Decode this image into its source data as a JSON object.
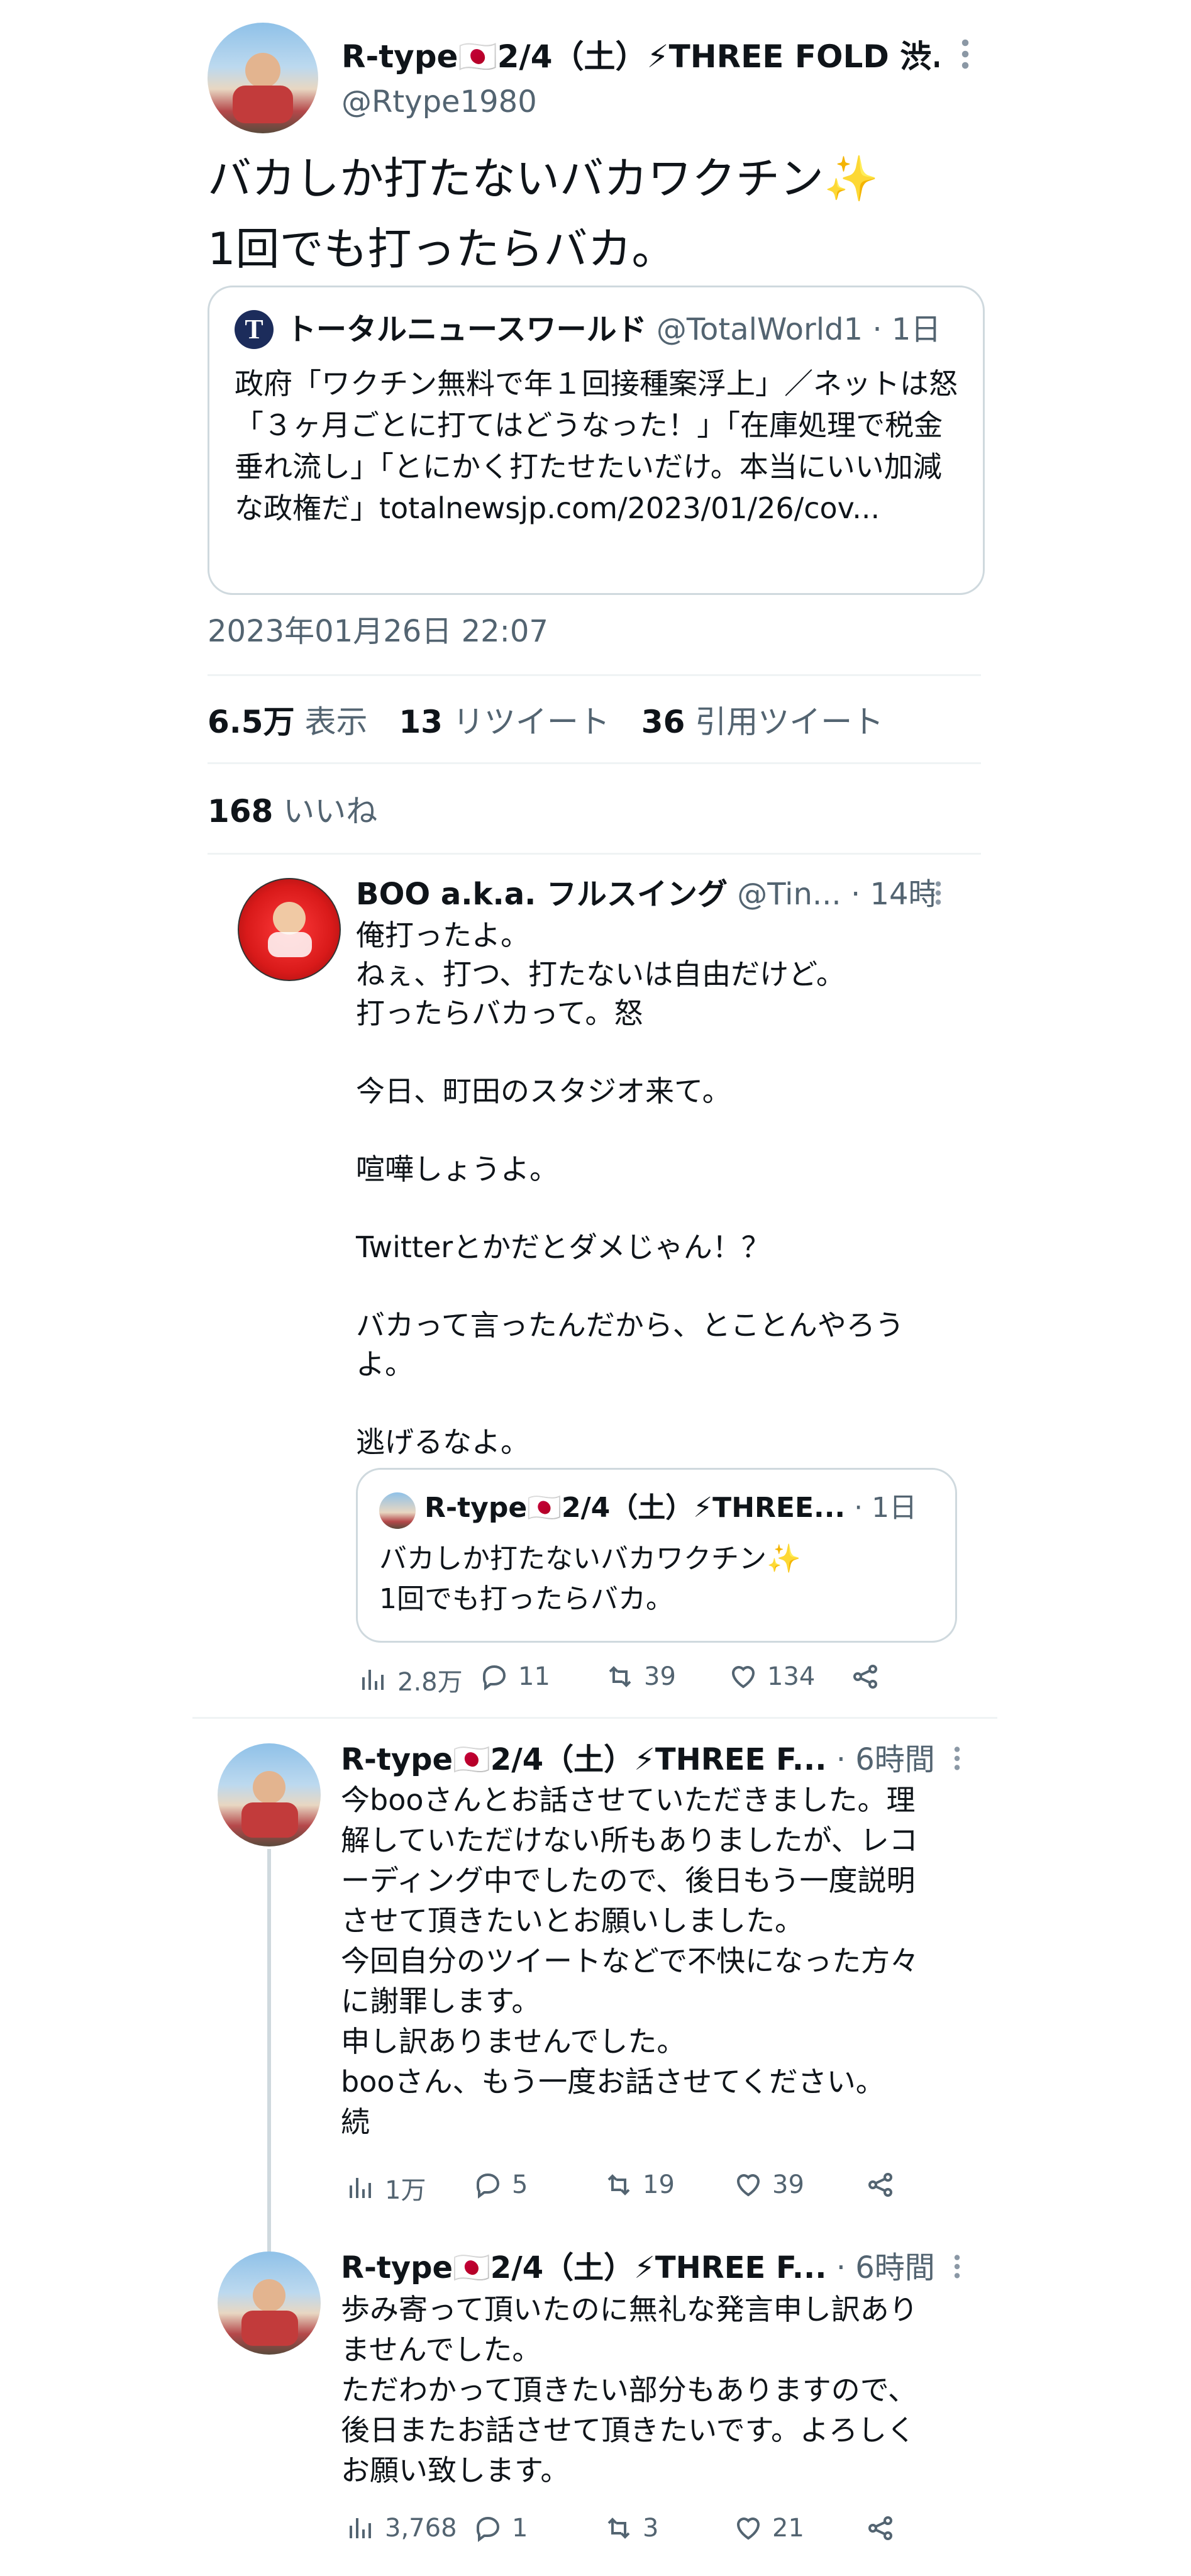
{
  "main_tweet": {
    "display_name": "R-type🇯🇵2/4（土）⚡THREE FOLD 渋...",
    "handle": "@Rtype1980",
    "text": "バカしか打たないバカワクチン✨\n1回でも打ったらバカ。",
    "quoted": {
      "source_name": "トータルニュースワールド",
      "source_handle": "@TotalWorld1",
      "age": "· 1日",
      "logo_letter": "T",
      "text": "政府「ワクチン無料で年１回接種案浮上」／ネットは怒「３ヶ月ごとに打てはどうなった！」「在庫処理で税金垂れ流し」「とにかく打たせたいだけ。本当にいい加減な政権だ」totalnewsjp.com/2023/01/26/cov..."
    },
    "timestamp": "2023年01月26日 22:07",
    "stats": {
      "views_count": "6.5万",
      "views_label": "表示",
      "retweets_count": "13",
      "retweets_label": "リツイート",
      "quotes_count": "36",
      "quotes_label": "引用ツイート",
      "likes_count": "168",
      "likes_label": "いいね"
    }
  },
  "reply_boo": {
    "display_name": "BOO a.k.a. フルスイング",
    "handle": "@Tin...",
    "age": "· 14時間",
    "text": "俺打ったよ。\nねぇ、打つ、打たないは自由だけど。\n打ったらバカって。怒\n\n今日、町田のスタジオ来て。\n\n喧嘩しょうよ。\n\nTwitterとかだとダメじゃん！？\n\nバカって言ったんだから、とことんやろう\nよ。\n\n逃げるなよ。",
    "quoted": {
      "display_name": "R-type🇯🇵2/4（土）⚡THREE...",
      "age": "· 1日",
      "text": "バカしか打たないバカワクチン✨\n1回でも打ったらバカ。"
    },
    "actions": {
      "views": "2.8万",
      "replies": "11",
      "retweets": "39",
      "likes": "134"
    }
  },
  "reply_rtype_1": {
    "display_name": "R-type🇯🇵2/4（土）⚡THREE F...",
    "age": "· 6時間",
    "text": "今booさんとお話させていただきました。理\n解していただけない所もありましたが、レコ\nーディング中でしたので、後日もう一度説明\nさせて頂きたいとお願いしました。\n今回自分のツイートなどで不快になった方々\nに謝罪します。\n申し訳ありませんでした。\nbooさん、もう一度お話させてください。\n続",
    "actions": {
      "views": "1万",
      "replies": "5",
      "retweets": "19",
      "likes": "39"
    }
  },
  "reply_rtype_2": {
    "display_name": "R-type🇯🇵2/4（土）⚡THREE F...",
    "age": "· 6時間",
    "text": "歩み寄って頂いたのに無礼な発言申し訳あり\nませんでした。\nただわかって頂きたい部分もありますので、\n後日またお話させて頂きたいです。よろしく\nお願い致します。",
    "actions": {
      "views": "3,768",
      "replies": "1",
      "retweets": "3",
      "likes": "21"
    }
  },
  "colors": {
    "text": "#0f1419",
    "secondary": "#536471",
    "divider": "#eff3f4",
    "card_border": "#cfd9de",
    "boo_avatar": "#d91a1a",
    "news_logo": "#1c2c5b"
  },
  "icons": [
    "more-icon",
    "views-icon",
    "reply-icon",
    "retweet-icon",
    "like-icon",
    "share-icon"
  ]
}
